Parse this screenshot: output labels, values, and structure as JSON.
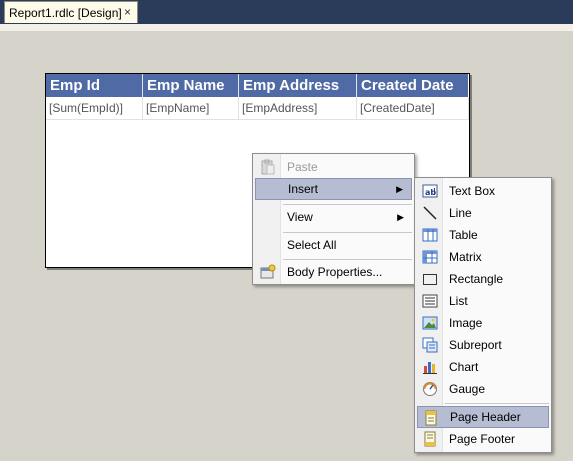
{
  "tab": {
    "title": "Report1.rdlc [Design]",
    "close": "×"
  },
  "table": {
    "headers": [
      "Emp Id",
      "Emp Name",
      "Emp Address",
      "Created Date"
    ],
    "cells": [
      "[Sum(EmpId)]",
      "[EmpName]",
      "[EmpAddress]",
      "[CreatedDate]"
    ]
  },
  "context_menu": {
    "items": [
      {
        "label": "Paste",
        "disabled": true
      },
      {
        "label": "Insert",
        "submenu": true
      },
      {
        "label": "View",
        "submenu": true
      },
      {
        "label": "Select All"
      },
      {
        "label": "Body Properties..."
      }
    ]
  },
  "insert_menu": {
    "items": [
      {
        "label": "Text Box",
        "icon": "textbox-icon"
      },
      {
        "label": "Line",
        "icon": "line-icon"
      },
      {
        "label": "Table",
        "icon": "table-icon"
      },
      {
        "label": "Matrix",
        "icon": "matrix-icon"
      },
      {
        "label": "Rectangle",
        "icon": "rectangle-icon"
      },
      {
        "label": "List",
        "icon": "list-icon"
      },
      {
        "label": "Image",
        "icon": "image-icon"
      },
      {
        "label": "Subreport",
        "icon": "subreport-icon"
      },
      {
        "label": "Chart",
        "icon": "chart-icon"
      },
      {
        "label": "Gauge",
        "icon": "gauge-icon"
      },
      {
        "label": "Page Header",
        "icon": "page-header-icon"
      },
      {
        "label": "Page Footer",
        "icon": "page-footer-icon"
      }
    ]
  }
}
